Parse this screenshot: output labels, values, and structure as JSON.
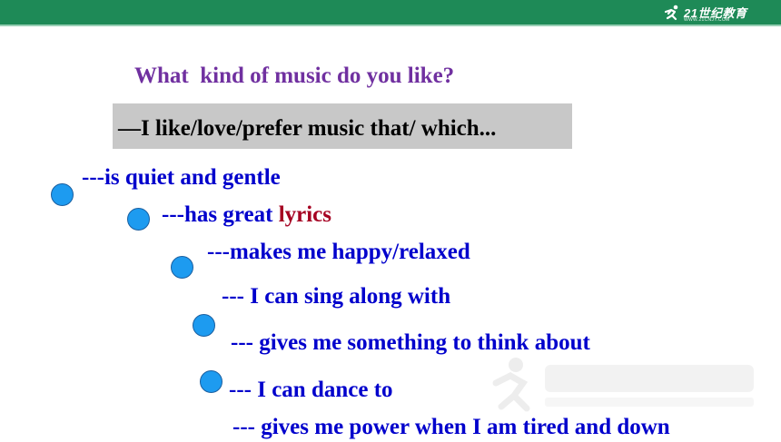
{
  "header": {
    "logo_text": "21世纪教育",
    "logo_subtext": "WWW.21CNJY.COM"
  },
  "slide": {
    "question": "What  kind of music do you like?",
    "answer_prompt": "—I like/love/prefer music that/ which...",
    "items": [
      {
        "text": "---is quiet and gentle"
      },
      {
        "prefix": "---has great ",
        "highlight": "lyrics"
      },
      {
        "text": "---makes me happy/relaxed"
      },
      {
        "text": "--- I can sing along with"
      },
      {
        "text": "--- gives me something to think about"
      },
      {
        "text": "--- I can dance to"
      },
      {
        "text": "--- gives me power when I am tired and down"
      }
    ]
  },
  "colors": {
    "header_bar": "#1e8a57",
    "question_text": "#7030a0",
    "item_text": "#0000cc",
    "highlight_text": "#a50021",
    "bullet": "#1d9bf0",
    "answer_box": "#c8c8c8"
  },
  "icons": {
    "logo": "runner-logo-icon",
    "bullet": "circle-bullet-icon"
  }
}
